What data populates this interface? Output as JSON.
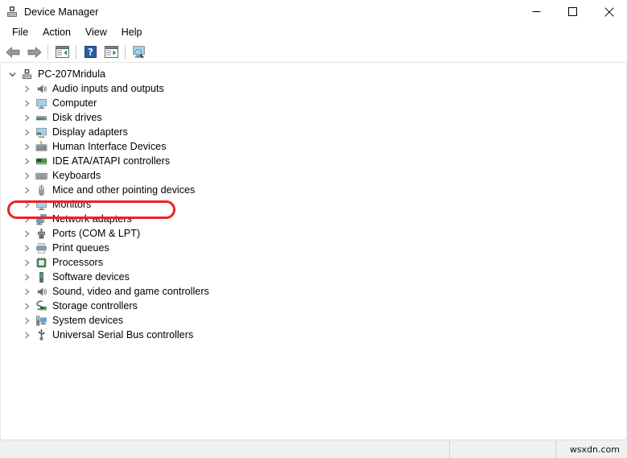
{
  "window": {
    "title": "Device Manager",
    "title_icon": "computer-device-icon",
    "controls": {
      "minimize": "minimize-icon",
      "maximize": "maximize-icon",
      "close": "close-icon"
    }
  },
  "menubar": {
    "items": [
      {
        "label": "File"
      },
      {
        "label": "Action"
      },
      {
        "label": "View"
      },
      {
        "label": "Help"
      }
    ]
  },
  "toolbar": {
    "buttons": [
      {
        "name": "back-arrow-icon",
        "tip": "Back"
      },
      {
        "name": "forward-arrow-icon",
        "tip": "Forward"
      },
      {
        "name": "show-hide-console-tree-icon",
        "tip": "Show/Hide Console Tree"
      },
      {
        "name": "help-question-icon",
        "tip": "Help"
      },
      {
        "name": "properties-icon",
        "tip": "Properties"
      },
      {
        "name": "scan-for-hardware-changes-icon",
        "tip": "Scan for hardware changes"
      }
    ]
  },
  "tree": {
    "root": {
      "label": "PC-207Mridula",
      "icon": "computer-device-icon",
      "expanded": true,
      "twisty": "chevron-down-icon"
    },
    "items": [
      {
        "label": "Audio inputs and outputs",
        "icon": "speaker-icon",
        "twisty": "chevron-right-icon",
        "expanded": false
      },
      {
        "label": "Computer",
        "icon": "monitor-icon",
        "twisty": "chevron-right-icon",
        "expanded": false
      },
      {
        "label": "Disk drives",
        "icon": "disk-drive-icon",
        "twisty": "chevron-right-icon",
        "expanded": false
      },
      {
        "label": "Display adapters",
        "icon": "display-adapter-icon",
        "twisty": "chevron-right-icon",
        "expanded": false
      },
      {
        "label": "Human Interface Devices",
        "icon": "hid-keyboard-icon",
        "twisty": "chevron-right-icon",
        "expanded": false,
        "highlighted": true
      },
      {
        "label": "IDE ATA/ATAPI controllers",
        "icon": "ide-controller-icon",
        "twisty": "chevron-right-icon",
        "expanded": false
      },
      {
        "label": "Keyboards",
        "icon": "keyboard-icon",
        "twisty": "chevron-right-icon",
        "expanded": false
      },
      {
        "label": "Mice and other pointing devices",
        "icon": "mouse-icon",
        "twisty": "chevron-right-icon",
        "expanded": false
      },
      {
        "label": "Monitors",
        "icon": "monitor-icon",
        "twisty": "chevron-right-icon",
        "expanded": false
      },
      {
        "label": "Network adapters",
        "icon": "network-adapter-icon",
        "twisty": "chevron-right-icon",
        "expanded": false
      },
      {
        "label": "Ports (COM & LPT)",
        "icon": "port-connector-icon",
        "twisty": "chevron-right-icon",
        "expanded": false
      },
      {
        "label": "Print queues",
        "icon": "printer-icon",
        "twisty": "chevron-right-icon",
        "expanded": false
      },
      {
        "label": "Processors",
        "icon": "processor-chip-icon",
        "twisty": "chevron-right-icon",
        "expanded": false
      },
      {
        "label": "Software devices",
        "icon": "software-device-icon",
        "twisty": "chevron-right-icon",
        "expanded": false
      },
      {
        "label": "Sound, video and game controllers",
        "icon": "speaker-icon",
        "twisty": "chevron-right-icon",
        "expanded": false
      },
      {
        "label": "Storage controllers",
        "icon": "storage-controller-icon",
        "twisty": "chevron-right-icon",
        "expanded": false
      },
      {
        "label": "System devices",
        "icon": "system-device-icon",
        "twisty": "chevron-right-icon",
        "expanded": false
      },
      {
        "label": "Universal Serial Bus controllers",
        "icon": "usb-controller-icon",
        "twisty": "chevron-right-icon",
        "expanded": false
      }
    ]
  },
  "annotation": {
    "target_label": "Human Interface Devices",
    "shape": "rounded-rectangle-outline",
    "color": "#ee2222"
  },
  "statusbar": {
    "pane1": "",
    "pane2": "",
    "watermark": "wsxdn.com"
  },
  "colors": {
    "accent_blue": "#2a6ebb",
    "icon_gray": "#6d6d6d",
    "annotation_red": "#ee2222",
    "window_bg": "#ffffff",
    "statusbar_bg": "#f0f0f0"
  }
}
